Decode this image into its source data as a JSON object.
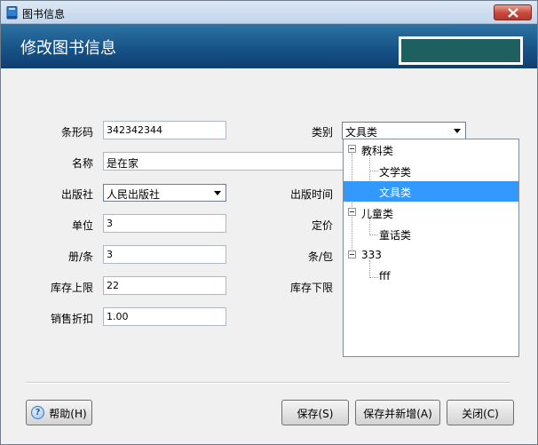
{
  "window": {
    "title": "图书信息"
  },
  "banner": {
    "title": "修改图书信息"
  },
  "form": {
    "barcode": {
      "label": "条形码",
      "value": "342342344"
    },
    "name": {
      "label": "名称",
      "value": "是在家"
    },
    "publisher": {
      "label": "出版社",
      "value": "人民出版社"
    },
    "unit": {
      "label": "单位",
      "value": "3"
    },
    "volume": {
      "label": "册/条",
      "value": "3"
    },
    "stock_upper": {
      "label": "库存上限",
      "value": "22"
    },
    "discount": {
      "label": "销售折扣",
      "value": "1.00"
    },
    "category": {
      "label": "类别",
      "value": "文具类"
    },
    "pub_time": {
      "label": "出版时间"
    },
    "price": {
      "label": "定价"
    },
    "per_pack": {
      "label": "条/包"
    },
    "stock_lower": {
      "label": "库存下限"
    }
  },
  "tree": {
    "items": [
      {
        "label": "教科类",
        "level": 0,
        "expanded": true
      },
      {
        "label": "文学类",
        "level": 1
      },
      {
        "label": "文具类",
        "level": 1,
        "selected": true
      },
      {
        "label": "儿童类",
        "level": 0,
        "expanded": true
      },
      {
        "label": "童话类",
        "level": 1
      },
      {
        "label": "333",
        "level": 0,
        "expanded": true
      },
      {
        "label": "fff",
        "level": 1
      }
    ]
  },
  "buttons": {
    "help": "帮助(H)",
    "save": "保存(S)",
    "save_new": "保存并新增(A)",
    "close": "关闭(C)"
  },
  "colors": {
    "banner": "#175387",
    "banner_box": "#1e5f5f",
    "selection": "#3399ff"
  },
  "icons": {
    "title": "book-icon",
    "close": "close-icon",
    "help": "help-icon",
    "dropdown": "chevron-down-icon"
  }
}
